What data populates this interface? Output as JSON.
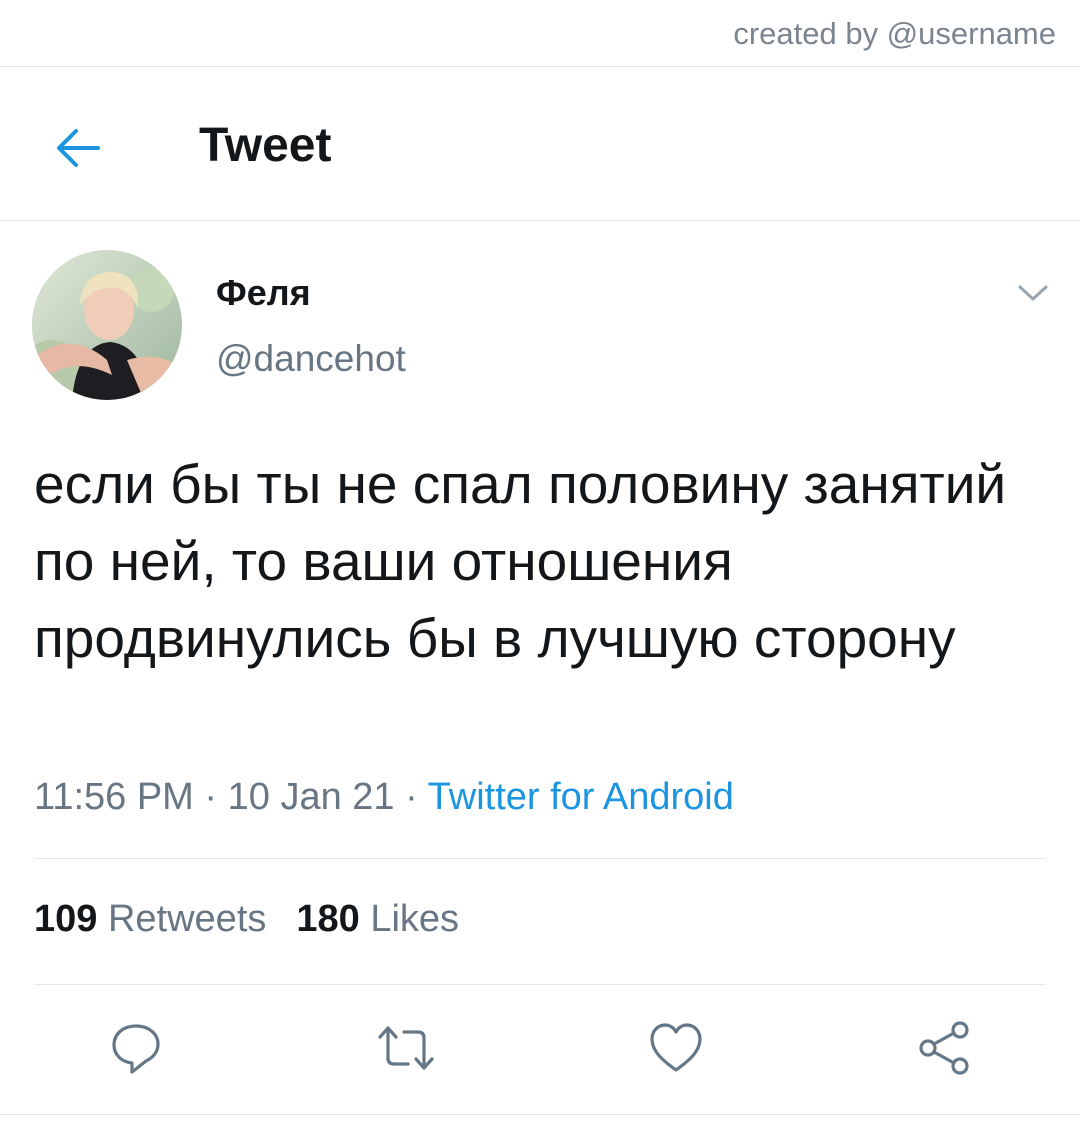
{
  "watermark": "created by @username",
  "header": {
    "title": "Tweet",
    "back_icon": "arrow-left-icon"
  },
  "tweet": {
    "author_name": "Феля",
    "author_handle": "@dancehot",
    "text": "если бы ты не спал половину занятий по ней, то ваши отношения продвинулись бы в лучшую сторону",
    "time": "11:56 PM",
    "date": "10 Jan 21",
    "source": "Twitter for Android",
    "separator": " · "
  },
  "stats": {
    "retweets_count": "109",
    "retweets_label": "Retweets",
    "likes_count": "180",
    "likes_label": "Likes"
  },
  "actions": [
    "reply-icon",
    "retweet-icon",
    "like-icon",
    "share-icon"
  ],
  "colors": {
    "accent": "#1b95e0",
    "text": "#14171a",
    "secondary": "#687684",
    "divider": "#e2e7eb"
  }
}
